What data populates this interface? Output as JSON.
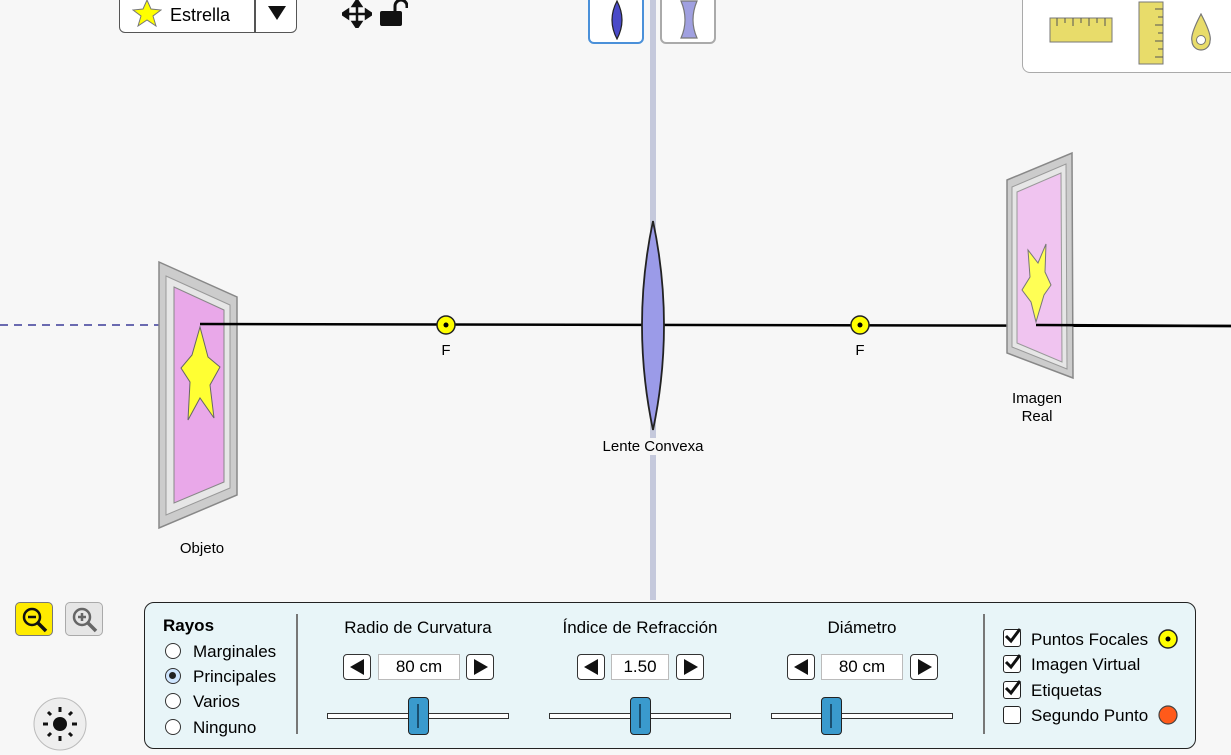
{
  "object_selector": {
    "label": "Estrella",
    "icon": "star-icon"
  },
  "lens_types": [
    {
      "name": "convex-lens-icon",
      "selected": true
    },
    {
      "name": "concave-lens-icon",
      "selected": false
    }
  ],
  "tools": [
    "ruler-horizontal-icon",
    "ruler-vertical-icon",
    "light-probe-icon"
  ],
  "scene": {
    "focal_label_left": "F",
    "focal_label_right": "F",
    "lens_label": "Lente Convexa",
    "object_label": "Objeto",
    "image_label_line1": "Imagen",
    "image_label_line2": "Real"
  },
  "rays": {
    "title": "Rayos",
    "options": [
      "Marginales",
      "Principales",
      "Varios",
      "Ninguno"
    ],
    "selected": "Principales"
  },
  "controls": {
    "radius": {
      "title": "Radio de Curvatura",
      "value": "80 cm",
      "level": 0.5
    },
    "index": {
      "title": "Índice de Refracción",
      "value": "1.50",
      "level": 0.5
    },
    "diameter": {
      "title": "Diámetro",
      "value": "80 cm",
      "level": 0.33
    }
  },
  "checks": {
    "focal_points": {
      "label": "Puntos Focales",
      "checked": true
    },
    "virtual_image": {
      "label": "Imagen Virtual",
      "checked": true
    },
    "labels": {
      "label": "Etiquetas",
      "checked": true
    },
    "second_point": {
      "label": "Segundo Punto",
      "checked": false
    }
  },
  "colors": {
    "accent": "#3a9acd",
    "focal": "#ffff00",
    "second_point": "#ff5a1a",
    "lens": "#9b9be8",
    "screen": "#e9a8e9"
  }
}
